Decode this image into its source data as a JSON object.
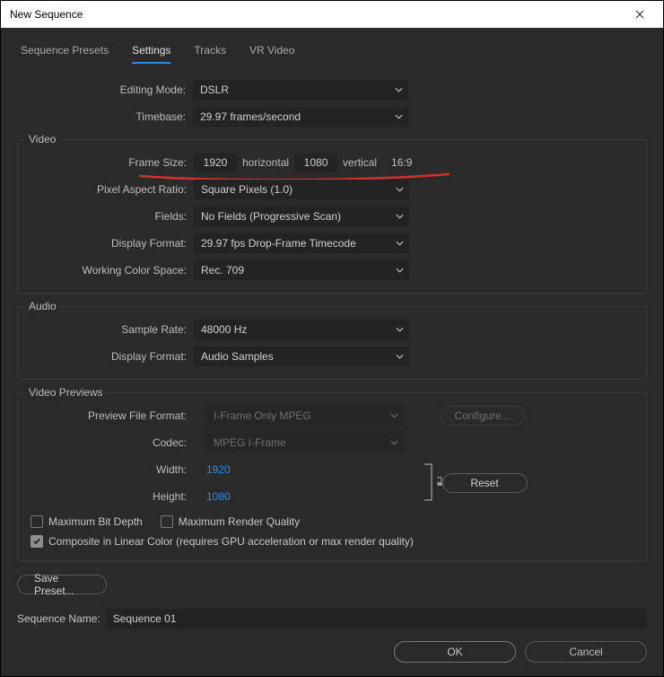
{
  "window": {
    "title": "New Sequence"
  },
  "tabs": [
    "Sequence Presets",
    "Settings",
    "Tracks",
    "VR Video"
  ],
  "activeTab": 1,
  "top": {
    "editingMode": {
      "label": "Editing Mode:",
      "value": "DSLR"
    },
    "timebase": {
      "label": "Timebase:",
      "value": "29.97  frames/second"
    }
  },
  "video": {
    "legend": "Video",
    "frameSize": {
      "label": "Frame Size:",
      "h": "1920",
      "hLabel": "horizontal",
      "v": "1080",
      "vLabel": "vertical",
      "ratio": "16:9"
    },
    "pixelAspect": {
      "label": "Pixel Aspect Ratio:",
      "value": "Square Pixels (1.0)"
    },
    "fields": {
      "label": "Fields:",
      "value": "No Fields (Progressive Scan)"
    },
    "displayFormat": {
      "label": "Display Format:",
      "value": "29.97 fps Drop-Frame Timecode"
    },
    "workingColorSpace": {
      "label": "Working Color Space:",
      "value": "Rec. 709"
    }
  },
  "audio": {
    "legend": "Audio",
    "sampleRate": {
      "label": "Sample Rate:",
      "value": "48000 Hz"
    },
    "displayFormat": {
      "label": "Display Format:",
      "value": "Audio Samples"
    }
  },
  "previews": {
    "legend": "Video Previews",
    "fileFormat": {
      "label": "Preview File Format:",
      "value": "I-Frame Only MPEG"
    },
    "configure": "Configure...",
    "codec": {
      "label": "Codec:",
      "value": "MPEG I-Frame"
    },
    "width": {
      "label": "Width:",
      "value": "1920"
    },
    "height": {
      "label": "Height:",
      "value": "1080"
    },
    "reset": "Reset",
    "maxBitDepth": "Maximum Bit Depth",
    "maxRenderQuality": "Maximum Render Quality",
    "compositeLinear": "Composite in Linear Color (requires GPU acceleration or max render quality)"
  },
  "savePreset": "Save Preset...",
  "sequenceName": {
    "label": "Sequence Name:",
    "value": "Sequence 01"
  },
  "buttons": {
    "ok": "OK",
    "cancel": "Cancel"
  }
}
